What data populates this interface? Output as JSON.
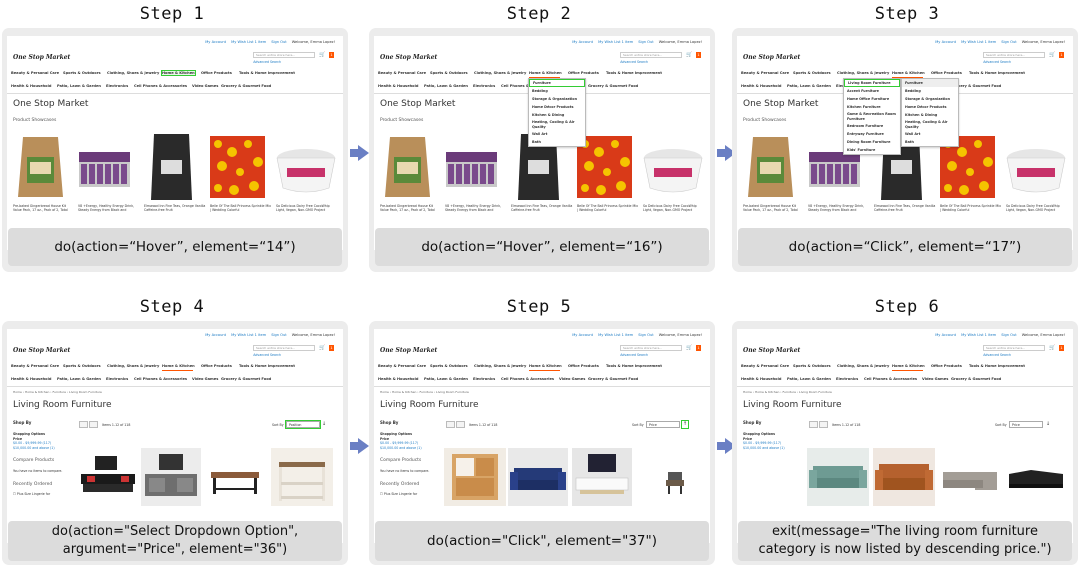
{
  "steps": [
    {
      "title": "Step 1",
      "action": "do(action=“Hover”, element=“14”)"
    },
    {
      "title": "Step 2",
      "action": "do(action=“Hover”, element=“16”)"
    },
    {
      "title": "Step 3",
      "action": "do(action=“Click”, element=“17”)"
    },
    {
      "title": "Step 4",
      "action_l1": "do(action=\"Select Dropdown Option\",",
      "action_l2": "argument=\"Price\", element=\"36\")"
    },
    {
      "title": "Step 5",
      "action": "do(action=\"Click\", element=\"37\")"
    },
    {
      "title": "Step 6",
      "action_l1": "exit(message=\"The living room furniture",
      "action_l2": "category is now listed by descending price.\")"
    }
  ],
  "site": {
    "top_links": [
      "My Account",
      "My Wish List 1 item",
      "Sign Out"
    ],
    "welcome": "Welcome, Emma Lopez!",
    "logo": "One Stop Market",
    "search_placeholder": "Search entire store here...",
    "advanced_search": "Advanced Search",
    "cart_count": "1",
    "nav_row1": [
      "Beauty & Personal Care",
      "Sports & Outdoors",
      "Clothing, Shoes & Jewelry",
      "Home & Kitchen",
      "Office Products",
      "Tools & Home Improvement"
    ],
    "nav_row2": [
      "Health & Household",
      "Patio, Lawn & Garden",
      "Electronics",
      "Cell Phones & Accessories",
      "Video Games",
      "Grocery & Gourmet Food"
    ],
    "home_title": "One Stop Market",
    "showcase": "Product Showcases",
    "products": [
      "Pre-baked Gingerbread House Kit Value Pack, 17 oz., Pack of 2, Total",
      "V8 +Energy, Healthy Energy Drink, Steady Energy from Black and",
      "Elmwood Inn Fine Teas, Orange Vanilla Caffeine-free Fruit",
      "Belle Of The Ball Princess Sprinkle Mix | Wedding Colorful",
      "So Delicious Dairy Free CocoWhip Light, Vegan, Non-GMO Project"
    ],
    "home_kitchen_menu": [
      "Furniture",
      "Bedding",
      "Storage & Organization",
      "Home Décor Products",
      "Kitchen & Dining",
      "Heating, Cooling & Air Quality",
      "Wall Art",
      "Bath"
    ],
    "furniture_menu": [
      "Living Room Furniture",
      "Accent Furniture",
      "Home Office Furniture",
      "Kitchen Furniture",
      "Game & Recreation Room Furniture",
      "Bedroom Furniture",
      "Entryway Furniture",
      "Dining Room Furniture",
      "Kids' Furniture"
    ],
    "breadcrumb": "Home  ›  Home & Kitchen  ›  Furniture  ›  Living Room Furniture",
    "category_title": "Living Room Furniture",
    "shop_by": "Shop By",
    "shopping_options": "Shopping Options",
    "price_label": "Price",
    "price_ranges": [
      "$0.00 - $9,999.99 (117)",
      "$10,000.00 and above (1)"
    ],
    "items_text": "Items 1-12 of 118",
    "sort_by": "Sort By",
    "sort_position": "Position",
    "sort_price": "Price",
    "compare_title": "Compare Products",
    "compare_text": "You have no items to compare.",
    "recent_title": "Recently Ordered",
    "recent_item": "Plus Size Lingerie for"
  },
  "colors": {
    "link": "#1979c3",
    "accent": "#ff5501",
    "highlight": "#33cc33",
    "arrow": "#6a7fc4"
  }
}
